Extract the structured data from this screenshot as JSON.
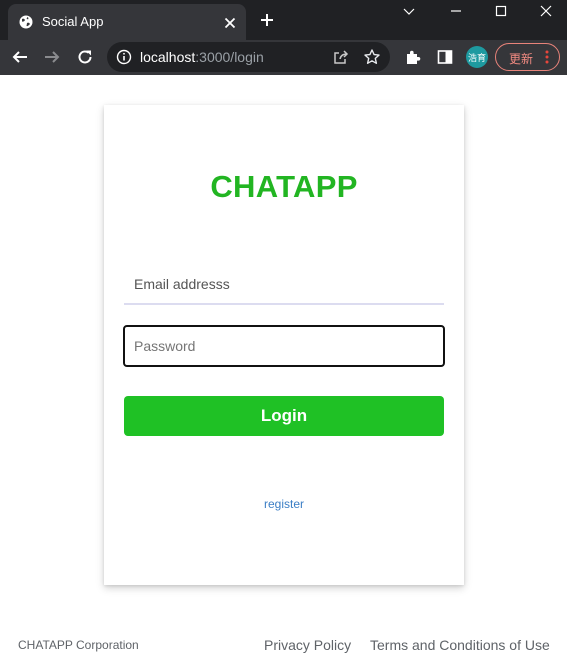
{
  "browser": {
    "tab": {
      "title": "Social App"
    },
    "url": {
      "host": "localhost",
      "path": ":3000/login"
    },
    "profile_label": "浩育",
    "update_label": "更新"
  },
  "login": {
    "brand": "CHATAPP",
    "email_placeholder": "Email addresss",
    "password_placeholder": "Password",
    "login_label": "Login",
    "register_label": "register"
  },
  "footer": {
    "company": "CHATAPP Corporation",
    "privacy": "Privacy Policy",
    "terms": "Terms and Conditions of Use"
  },
  "colors": {
    "brand_green": "#22b522",
    "button_green": "#1fc125",
    "link_blue": "#3b7ec5"
  }
}
